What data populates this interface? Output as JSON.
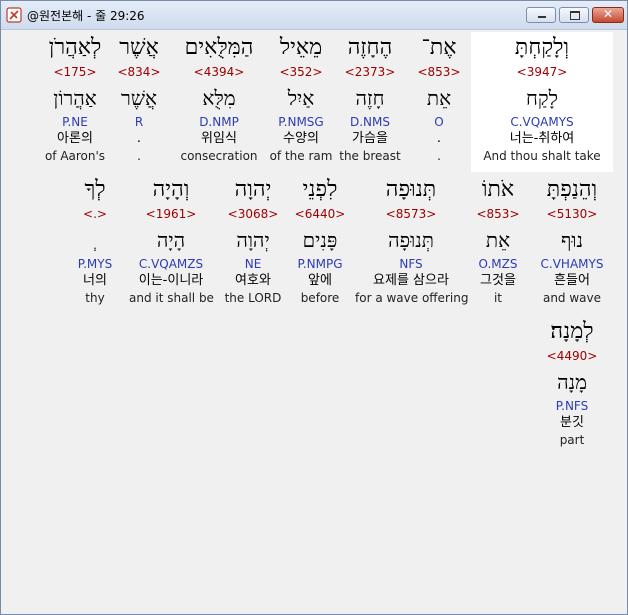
{
  "window": {
    "title": "@원전본해 - 줄 29:26",
    "icon_name": "bible-app-icon",
    "buttons": {
      "minimize": "minimize-icon",
      "maximize": "maximize-icon",
      "close_glyph": "✕"
    }
  },
  "rows": [
    {
      "words": [
        {
          "heb": "וְלָקַחְתָּ",
          "num": "<3947>",
          "root": "לָקַח",
          "morph": "C.VQAMYS",
          "kor": "너는-취하여",
          "eng": "And thou shalt take",
          "selected": true
        },
        {
          "heb": "אֶת־",
          "num": "<853>",
          "root": "אֵת",
          "morph": "O",
          "kor": ".",
          "eng": "."
        },
        {
          "heb": "הֶחָזֶה",
          "num": "<2373>",
          "root": "חָזֶה",
          "morph": "D.NMS",
          "kor": "가슴을",
          "eng": "the breast"
        },
        {
          "heb": "מֵאֵיל",
          "num": "<352>",
          "root": "אַיִל",
          "morph": "P.NMSG",
          "kor": "수양의",
          "eng": "of the ram"
        },
        {
          "heb": "הַמִּלֻּאִים",
          "num": "<4394>",
          "root": "מִלֻּא",
          "morph": "D.NMP",
          "kor": "위임식",
          "eng": "consecration"
        },
        {
          "heb": "אֲשֶׁר",
          "num": "<834>",
          "root": "אֲשֶׁר",
          "morph": "R",
          "kor": ".",
          "eng": "."
        },
        {
          "heb": "לְאַהֲרֹן",
          "num": "<175>",
          "root": "אַהֲרוֹן",
          "morph": "P.NE",
          "kor": "아론의",
          "eng": "of Aaron's"
        }
      ]
    },
    {
      "words": [
        {
          "heb": "וְהֵנַפְתָּ",
          "num": "<5130>",
          "root": "נוּף",
          "morph": "C.VHAMYS",
          "kor": "흔들어",
          "eng": "and wave"
        },
        {
          "heb": "אֹתוֹ",
          "num": "<853>",
          "root": "אֵת",
          "morph": "O.MZS",
          "kor": "그것을",
          "eng": "it"
        },
        {
          "heb": "תְּנוּפָה",
          "num": "<8573>",
          "root": "תְּנוּפָה",
          "morph": "NFS",
          "kor": "요제를 삼으라",
          "eng": "for a wave offering"
        },
        {
          "heb": "לִפְנֵי",
          "num": "<6440>",
          "root": "פָּנִים",
          "morph": "P.NMPG",
          "kor": "앞에",
          "eng": "before"
        },
        {
          "heb": "יְהוָה",
          "num": "<3068>",
          "root": "יְהוָה",
          "morph": "NE",
          "kor": "여호와",
          "eng": "the LORD"
        },
        {
          "heb": "וְהָיָה",
          "num": "<1961>",
          "root": "הָיָה",
          "morph": "C.VQAMZS",
          "kor": "이는-이니라",
          "eng": "and it shall be"
        },
        {
          "heb": "לְךָ",
          "num": "<.>",
          "root": "ְ",
          "morph": "P.MYS",
          "kor": "너의",
          "eng": "thy"
        }
      ]
    },
    {
      "words": [
        {
          "heb": "לְמָנָה׃",
          "num": "<4490>",
          "root": "מָנָה",
          "morph": "P.NFS",
          "kor": "분깃",
          "eng": "part"
        }
      ]
    }
  ]
}
